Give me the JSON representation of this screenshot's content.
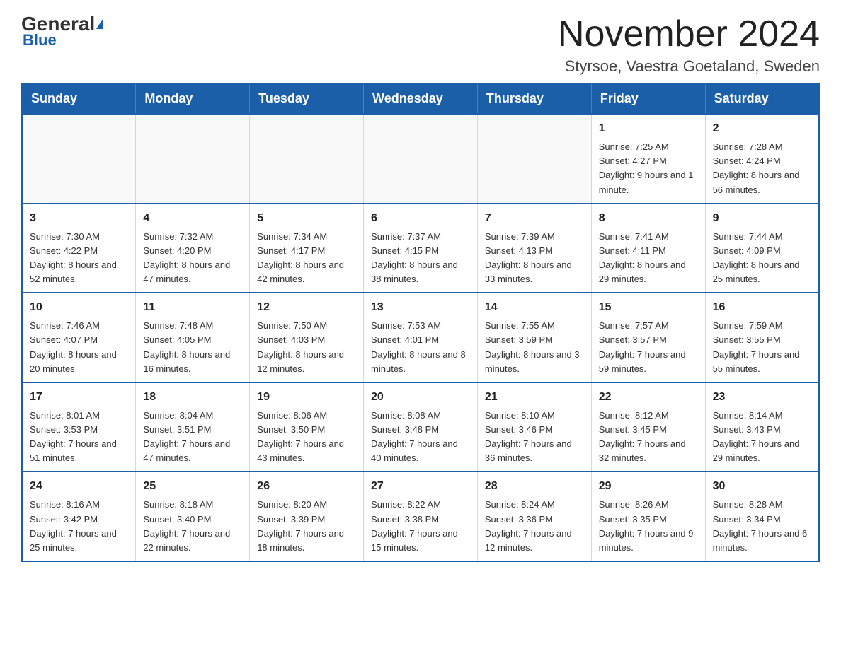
{
  "header": {
    "logo_general": "General",
    "logo_blue": "Blue",
    "month_title": "November 2024",
    "location": "Styrsoe, Vaestra Goetaland, Sweden"
  },
  "days_of_week": [
    "Sunday",
    "Monday",
    "Tuesday",
    "Wednesday",
    "Thursday",
    "Friday",
    "Saturday"
  ],
  "weeks": [
    [
      {
        "day": "",
        "info": ""
      },
      {
        "day": "",
        "info": ""
      },
      {
        "day": "",
        "info": ""
      },
      {
        "day": "",
        "info": ""
      },
      {
        "day": "",
        "info": ""
      },
      {
        "day": "1",
        "info": "Sunrise: 7:25 AM\nSunset: 4:27 PM\nDaylight: 9 hours and 1 minute."
      },
      {
        "day": "2",
        "info": "Sunrise: 7:28 AM\nSunset: 4:24 PM\nDaylight: 8 hours and 56 minutes."
      }
    ],
    [
      {
        "day": "3",
        "info": "Sunrise: 7:30 AM\nSunset: 4:22 PM\nDaylight: 8 hours and 52 minutes."
      },
      {
        "day": "4",
        "info": "Sunrise: 7:32 AM\nSunset: 4:20 PM\nDaylight: 8 hours and 47 minutes."
      },
      {
        "day": "5",
        "info": "Sunrise: 7:34 AM\nSunset: 4:17 PM\nDaylight: 8 hours and 42 minutes."
      },
      {
        "day": "6",
        "info": "Sunrise: 7:37 AM\nSunset: 4:15 PM\nDaylight: 8 hours and 38 minutes."
      },
      {
        "day": "7",
        "info": "Sunrise: 7:39 AM\nSunset: 4:13 PM\nDaylight: 8 hours and 33 minutes."
      },
      {
        "day": "8",
        "info": "Sunrise: 7:41 AM\nSunset: 4:11 PM\nDaylight: 8 hours and 29 minutes."
      },
      {
        "day": "9",
        "info": "Sunrise: 7:44 AM\nSunset: 4:09 PM\nDaylight: 8 hours and 25 minutes."
      }
    ],
    [
      {
        "day": "10",
        "info": "Sunrise: 7:46 AM\nSunset: 4:07 PM\nDaylight: 8 hours and 20 minutes."
      },
      {
        "day": "11",
        "info": "Sunrise: 7:48 AM\nSunset: 4:05 PM\nDaylight: 8 hours and 16 minutes."
      },
      {
        "day": "12",
        "info": "Sunrise: 7:50 AM\nSunset: 4:03 PM\nDaylight: 8 hours and 12 minutes."
      },
      {
        "day": "13",
        "info": "Sunrise: 7:53 AM\nSunset: 4:01 PM\nDaylight: 8 hours and 8 minutes."
      },
      {
        "day": "14",
        "info": "Sunrise: 7:55 AM\nSunset: 3:59 PM\nDaylight: 8 hours and 3 minutes."
      },
      {
        "day": "15",
        "info": "Sunrise: 7:57 AM\nSunset: 3:57 PM\nDaylight: 7 hours and 59 minutes."
      },
      {
        "day": "16",
        "info": "Sunrise: 7:59 AM\nSunset: 3:55 PM\nDaylight: 7 hours and 55 minutes."
      }
    ],
    [
      {
        "day": "17",
        "info": "Sunrise: 8:01 AM\nSunset: 3:53 PM\nDaylight: 7 hours and 51 minutes."
      },
      {
        "day": "18",
        "info": "Sunrise: 8:04 AM\nSunset: 3:51 PM\nDaylight: 7 hours and 47 minutes."
      },
      {
        "day": "19",
        "info": "Sunrise: 8:06 AM\nSunset: 3:50 PM\nDaylight: 7 hours and 43 minutes."
      },
      {
        "day": "20",
        "info": "Sunrise: 8:08 AM\nSunset: 3:48 PM\nDaylight: 7 hours and 40 minutes."
      },
      {
        "day": "21",
        "info": "Sunrise: 8:10 AM\nSunset: 3:46 PM\nDaylight: 7 hours and 36 minutes."
      },
      {
        "day": "22",
        "info": "Sunrise: 8:12 AM\nSunset: 3:45 PM\nDaylight: 7 hours and 32 minutes."
      },
      {
        "day": "23",
        "info": "Sunrise: 8:14 AM\nSunset: 3:43 PM\nDaylight: 7 hours and 29 minutes."
      }
    ],
    [
      {
        "day": "24",
        "info": "Sunrise: 8:16 AM\nSunset: 3:42 PM\nDaylight: 7 hours and 25 minutes."
      },
      {
        "day": "25",
        "info": "Sunrise: 8:18 AM\nSunset: 3:40 PM\nDaylight: 7 hours and 22 minutes."
      },
      {
        "day": "26",
        "info": "Sunrise: 8:20 AM\nSunset: 3:39 PM\nDaylight: 7 hours and 18 minutes."
      },
      {
        "day": "27",
        "info": "Sunrise: 8:22 AM\nSunset: 3:38 PM\nDaylight: 7 hours and 15 minutes."
      },
      {
        "day": "28",
        "info": "Sunrise: 8:24 AM\nSunset: 3:36 PM\nDaylight: 7 hours and 12 minutes."
      },
      {
        "day": "29",
        "info": "Sunrise: 8:26 AM\nSunset: 3:35 PM\nDaylight: 7 hours and 9 minutes."
      },
      {
        "day": "30",
        "info": "Sunrise: 8:28 AM\nSunset: 3:34 PM\nDaylight: 7 hours and 6 minutes."
      }
    ]
  ]
}
